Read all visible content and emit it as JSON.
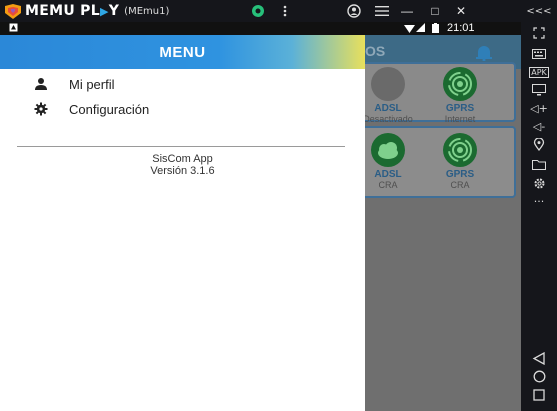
{
  "emulator": {
    "brand": "MEMU PL",
    "brand_tail": "Y",
    "instance": "(MEmu1)",
    "window_buttons": [
      "—",
      "□",
      "✕"
    ],
    "collapse_icon": "<<<",
    "toolbar_icons": [
      "expand-icon",
      "keyboard-icon",
      "apk-icon",
      "screen-icon",
      "volume-up-icon",
      "volume-down-icon",
      "location-icon",
      "folder-icon",
      "settings-icon",
      "more-icon"
    ],
    "toolbar_labels": {
      "apk": "APK",
      "more": "···",
      "volume_up": "◁+",
      "volume_down": "◁-"
    }
  },
  "statusbar": {
    "time": "21:01"
  },
  "background_app": {
    "title": "OS",
    "tiles_row1": [
      {
        "label": "ADSL",
        "sub": "Desactivado"
      },
      {
        "label": "GPRS",
        "sub": "Internet"
      }
    ],
    "tiles_row2": [
      {
        "label": "ADSL",
        "sub": "CRA"
      },
      {
        "label": "GPRS",
        "sub": "CRA"
      }
    ],
    "colors": {
      "appbar": "#3d6a86",
      "accent": "#2f93e0",
      "gprs": "#1b8f3a"
    }
  },
  "drawer": {
    "title": "MENU",
    "items": [
      {
        "label": "Mi perfil",
        "icon": "person-icon"
      },
      {
        "label": "Configuración",
        "icon": "gear-icon"
      }
    ],
    "app_name": "SisCom App",
    "version": "Versión 3.1.6"
  }
}
